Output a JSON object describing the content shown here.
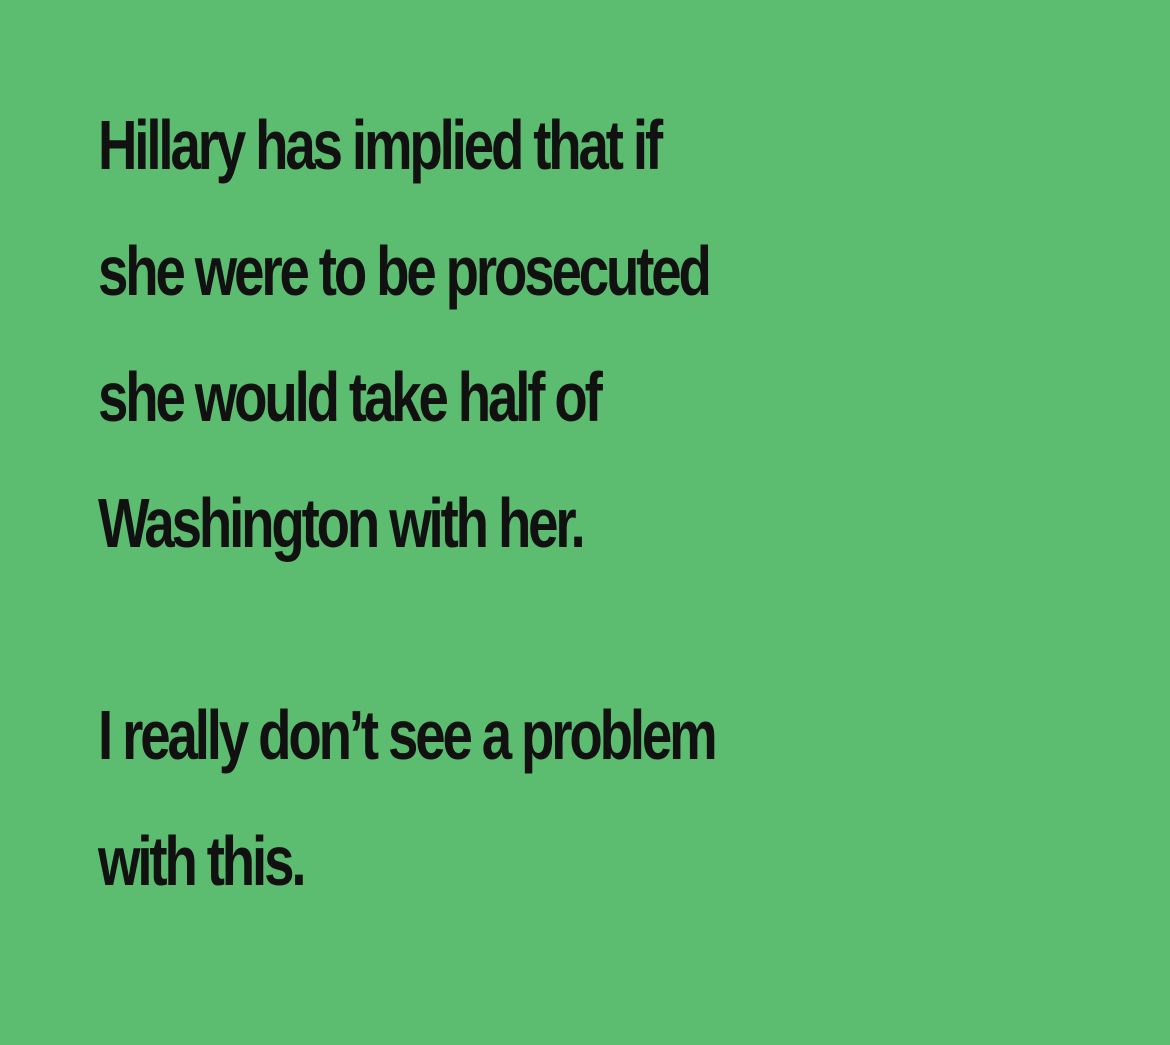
{
  "background_color": "#5cbd71",
  "text_color": "#111111",
  "paragraphs": [
    {
      "lines": [
        "Hillary has implied that if",
        "she were to be prosecuted",
        "she would take half of",
        "Washington with her."
      ]
    },
    {
      "lines": [
        "I really don’t see a problem",
        "with this."
      ]
    }
  ]
}
